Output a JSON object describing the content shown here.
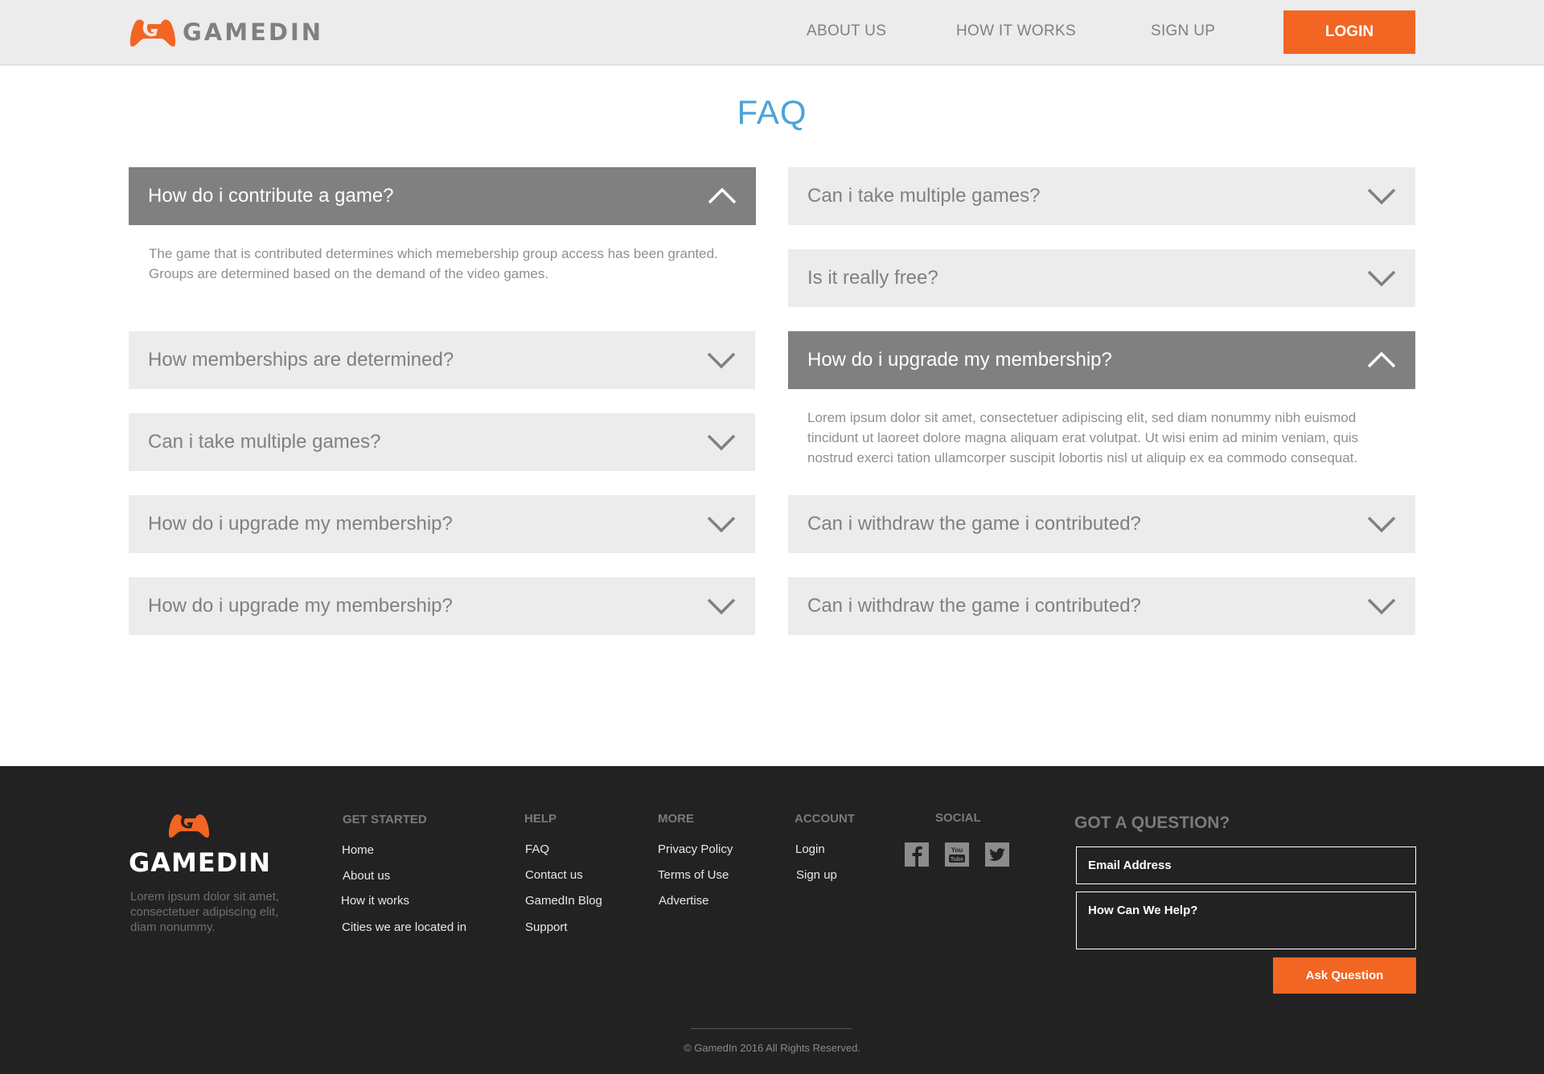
{
  "header": {
    "logo_text": "GAMEDIN",
    "nav": [
      {
        "label": "ABOUT US"
      },
      {
        "label": "HOW IT WORKS"
      },
      {
        "label": "SIGN UP"
      }
    ],
    "login_label": "LOGIN"
  },
  "main": {
    "title": "FAQ",
    "left": [
      {
        "question": "How do i contribute a game?",
        "open": true,
        "answer": "The game that is contributed determines which memebership group access has been granted. Groups are determined based on the demand of the video games."
      },
      {
        "question": "How memberships are determined?",
        "open": false
      },
      {
        "question": "Can i take multiple games?",
        "open": false
      },
      {
        "question": "How do i upgrade my membership?",
        "open": false
      },
      {
        "question": "How do i upgrade my membership?",
        "open": false
      }
    ],
    "right": [
      {
        "question": "Can i take multiple games?",
        "open": false
      },
      {
        "question": "Is it really free?",
        "open": false
      },
      {
        "question": "How do i upgrade my membership?",
        "open": true,
        "answer": "Lorem ipsum dolor sit amet, consectetuer adipiscing elit, sed diam nonummy nibh euismod tincidunt ut laoreet dolore magna aliquam erat volutpat. Ut wisi enim ad minim veniam, quis nostrud exerci tation ullamcorper suscipit lobortis nisl ut aliquip ex ea commodo consequat."
      },
      {
        "question": "Can i withdraw the game i contributed?",
        "open": false
      },
      {
        "question": "Can i withdraw the game i contributed?",
        "open": false
      }
    ]
  },
  "footer": {
    "logo_text": "GAMEDIN",
    "description": "Lorem ipsum dolor sit amet, consectetuer adipiscing elit, diam nonummy.",
    "columns": [
      {
        "heading": "GET STARTED",
        "links": [
          "Home",
          "About us",
          "How it works",
          "Cities we are located in"
        ]
      },
      {
        "heading": "HELP",
        "links": [
          "FAQ",
          "Contact us",
          "GamedIn Blog",
          "Support"
        ]
      },
      {
        "heading": "MORE",
        "links": [
          "Privacy Policy",
          "Terms of Use",
          "Advertise"
        ]
      },
      {
        "heading": "ACCOUNT",
        "links": [
          "Login",
          "Sign up"
        ]
      }
    ],
    "social_heading": "SOCIAL",
    "social_icons": [
      "facebook-icon",
      "youtube-icon",
      "twitter-icon"
    ],
    "question_title": "GOT A QUESTION?",
    "email_placeholder": "Email Address",
    "help_placeholder": "How Can We Help?",
    "ask_label": "Ask Question",
    "copyright": "© GamedIn 2016 All Rights Reserved."
  },
  "colors": {
    "accent": "#f26522",
    "title_blue": "#4ba3d9",
    "header_bg": "#ececec",
    "open_bg": "#808080",
    "footer_bg": "#222222"
  }
}
